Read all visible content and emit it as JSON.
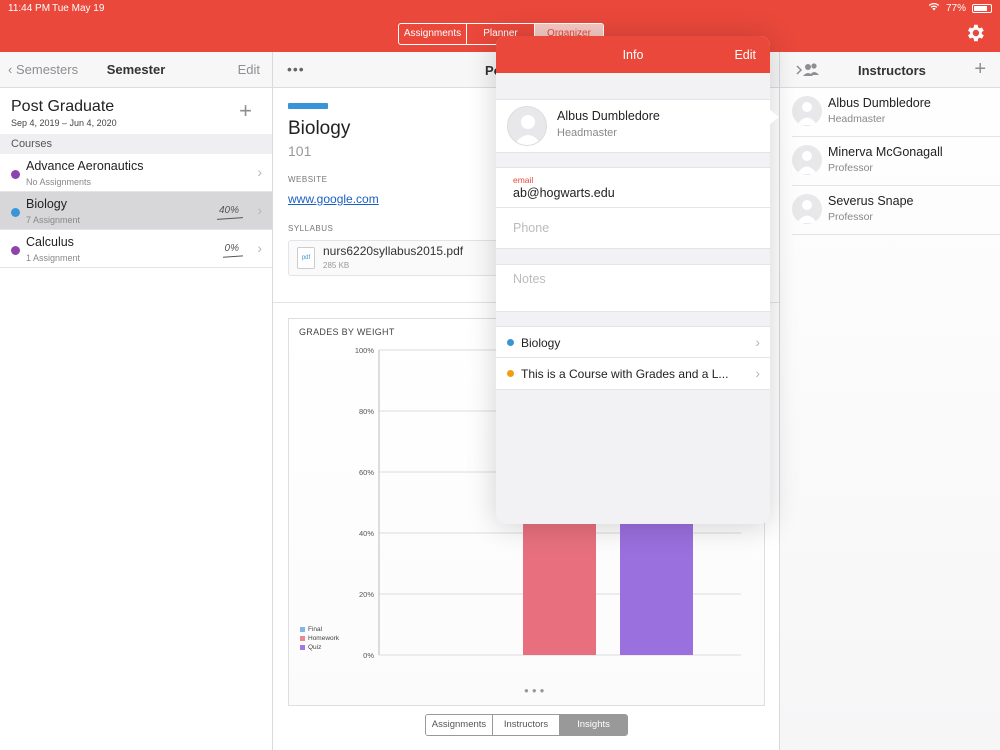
{
  "status": {
    "time": "11:44 PM",
    "date": "Tue May 19",
    "battery": "77%"
  },
  "top_tabs": [
    "Assignments",
    "Planner",
    "Organizer"
  ],
  "left": {
    "back_label": "Semesters",
    "title": "Semester",
    "edit_label": "Edit",
    "semester_name": "Post Graduate",
    "semester_dates": "Sep 4, 2019 – Jun 4, 2020",
    "section": "Courses",
    "courses": [
      {
        "name": "Advance Aeronautics",
        "sub": "No Assignments",
        "pct": "",
        "color": "#8e44ad",
        "selected": false
      },
      {
        "name": "Biology",
        "sub": "7 Assignment",
        "pct": "40%",
        "color": "#3a95d8",
        "selected": true
      },
      {
        "name": "Calculus",
        "sub": "1 Assignment",
        "pct": "0%",
        "color": "#8e44ad",
        "selected": false
      }
    ]
  },
  "middle": {
    "nav_title": "Po",
    "course_title": "Biology",
    "course_number": "101",
    "website_label": "WEBSITE",
    "website": "www.google.com",
    "syllabus_label": "SYLLABUS",
    "file_type": "pdf",
    "file_name": "nurs6220syllabus2015.pdf",
    "file_size": "285 KB",
    "bottom_tabs": [
      "Assignments",
      "Instructors",
      "Insights"
    ]
  },
  "chart_data": {
    "type": "bar",
    "title": "GRADES BY WEIGHT",
    "y_ticks": [
      "0%",
      "20%",
      "40%",
      "60%",
      "80%",
      "100%"
    ],
    "ylim": [
      0,
      100
    ],
    "legend": [
      {
        "name": "Final",
        "color": "#7fb7e6"
      },
      {
        "name": "Homework",
        "color": "#e88a93"
      },
      {
        "name": "Quiz",
        "color": "#a07ae0"
      }
    ],
    "series": [
      {
        "name": "Homework",
        "value": 47,
        "color": "#e8707e"
      },
      {
        "name": "Quiz",
        "value": 47,
        "color": "#9a6fde"
      }
    ]
  },
  "popover": {
    "title": "Info",
    "edit_label": "Edit",
    "name": "Albus Dumbledore",
    "role": "Headmaster",
    "email_label": "email",
    "email": "ab@hogwarts.edu",
    "phone_placeholder": "Phone",
    "notes_placeholder": "Notes",
    "courses": [
      {
        "name": "Biology",
        "color": "#3a95d8"
      },
      {
        "name": "This is a Course with Grades and a L...",
        "color": "#f39c12"
      }
    ]
  },
  "right": {
    "title": "Instructors",
    "instructors": [
      {
        "name": "Albus Dumbledore",
        "role": "Headmaster"
      },
      {
        "name": "Minerva McGonagall",
        "role": "Professor"
      },
      {
        "name": "Severus Snape",
        "role": "Professor"
      }
    ]
  }
}
